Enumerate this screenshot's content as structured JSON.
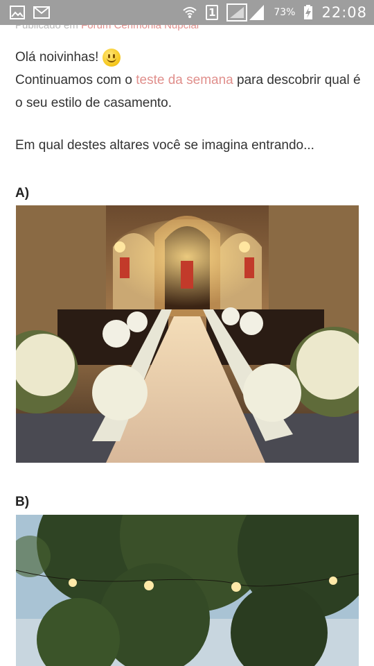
{
  "status_bar": {
    "sim_label": "1",
    "battery_percent": "73%",
    "time": "22:08",
    "icons": [
      "image-notification-icon",
      "mail-notification-icon",
      "wifi-icon",
      "sim-icon",
      "signal-icon",
      "battery-charging-icon"
    ]
  },
  "header": {
    "published_prefix": "Publicado em",
    "forum_name": "Fórum Cerimônia Nupcial"
  },
  "article": {
    "greeting": "Olá noivinhas!",
    "intro_before": "Continuamos com o ",
    "intro_link": "teste da semana",
    "intro_after": " para descobrir qual é o seu estilo de casamento.",
    "question": "Em qual destes altares você se imagina entrando...",
    "options": [
      {
        "label": "A)"
      },
      {
        "label": "B)"
      }
    ]
  },
  "colors": {
    "status_bar": "#9e9e9e",
    "link": "#e08f8c",
    "text": "#333333"
  }
}
